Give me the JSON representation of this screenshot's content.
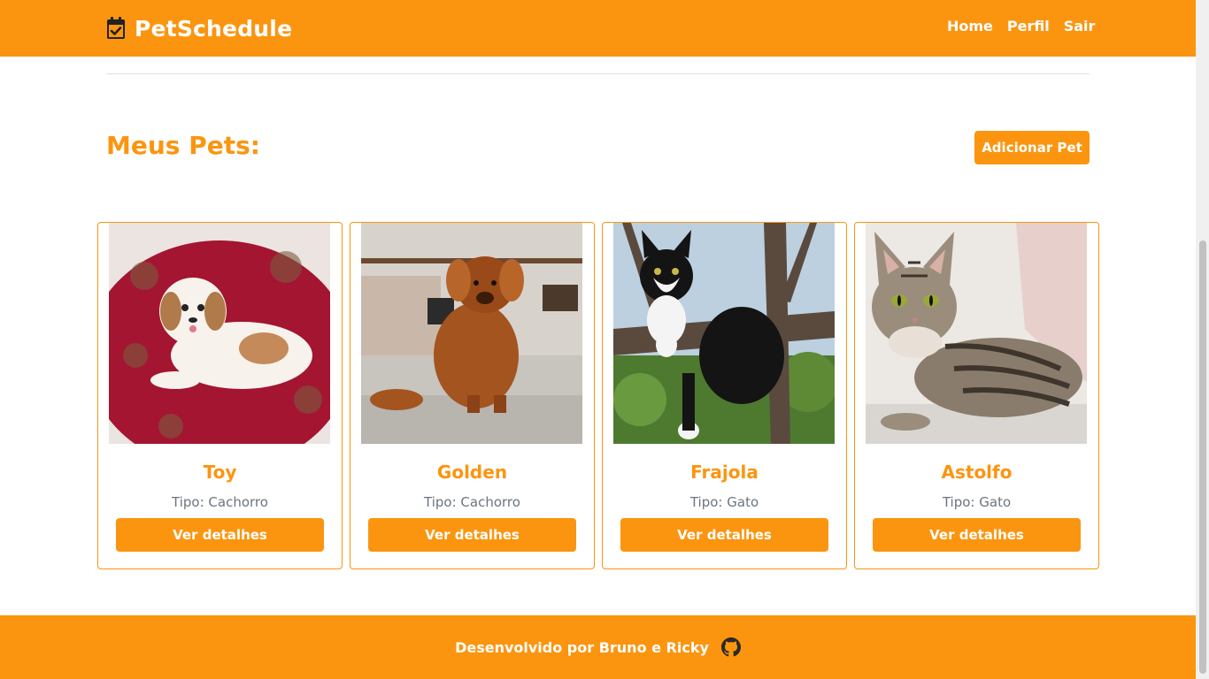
{
  "navbar": {
    "brand": "PetSchedule",
    "brand_icon": "calendar-check-icon",
    "links": [
      "Home",
      "Perfil",
      "Sair"
    ]
  },
  "main": {
    "title": "Meus Pets:",
    "add_button": "Adicionar Pet"
  },
  "pets": [
    {
      "name": "Toy",
      "type": "Tipo: Cachorro",
      "button": "Ver detalhes"
    },
    {
      "name": "Golden",
      "type": "Tipo: Cachorro",
      "button": "Ver detalhes"
    },
    {
      "name": "Frajola",
      "type": "Tipo: Gato",
      "button": "Ver detalhes"
    },
    {
      "name": "Astolfo",
      "type": "Tipo: Gato",
      "button": "Ver detalhes"
    }
  ],
  "footer": {
    "text": "Desenvolvido por Bruno e Ricky",
    "icon": "github-icon"
  },
  "colors": {
    "accent": "#fb9510",
    "muted_text": "#6b7580",
    "white": "#ffffff"
  }
}
